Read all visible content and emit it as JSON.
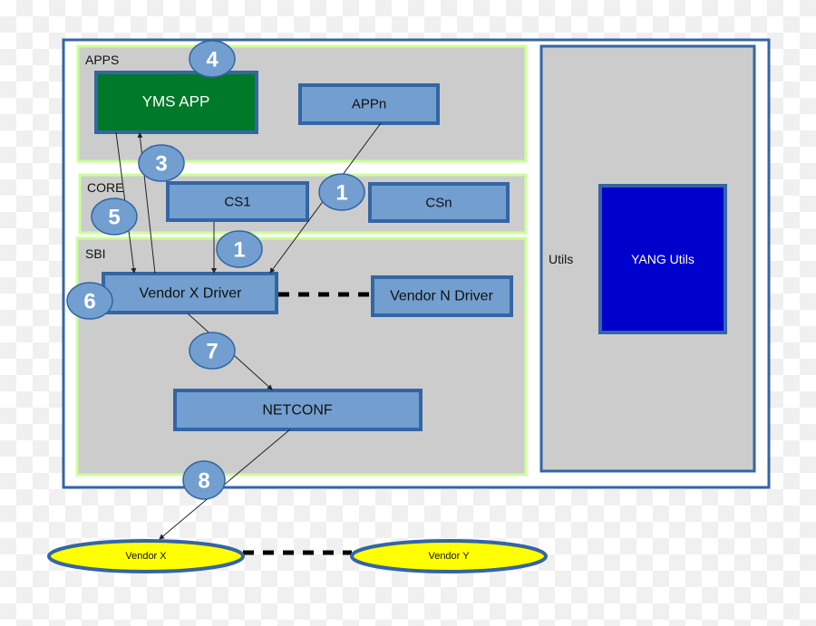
{
  "colors": {
    "frame": "#3465a4",
    "panel": "#cccccc",
    "panel_border": "#ccff99",
    "box": "#729fcf",
    "yms_app": "#007a28",
    "yang_utils": "#0000cc",
    "vendor_node": "#ffff00"
  },
  "layers": {
    "apps": "APPS",
    "core": "CORE",
    "sbi": "SBI",
    "utils": "Utils"
  },
  "boxes": {
    "yms_app": "YMS APP",
    "appn": "APPn",
    "cs1": "CS1",
    "csn": "CSn",
    "vendor_x_driver": "Vendor X Driver",
    "vendor_n_driver": "Vendor N Driver",
    "netconf": "NETCONF",
    "yang_utils": "YANG Utils"
  },
  "steps": [
    "4",
    "3",
    "1",
    "5",
    "1",
    "6",
    "7",
    "8"
  ],
  "devices": {
    "vendor_x": "Vendor X",
    "vendor_y": "Vendor Y"
  }
}
